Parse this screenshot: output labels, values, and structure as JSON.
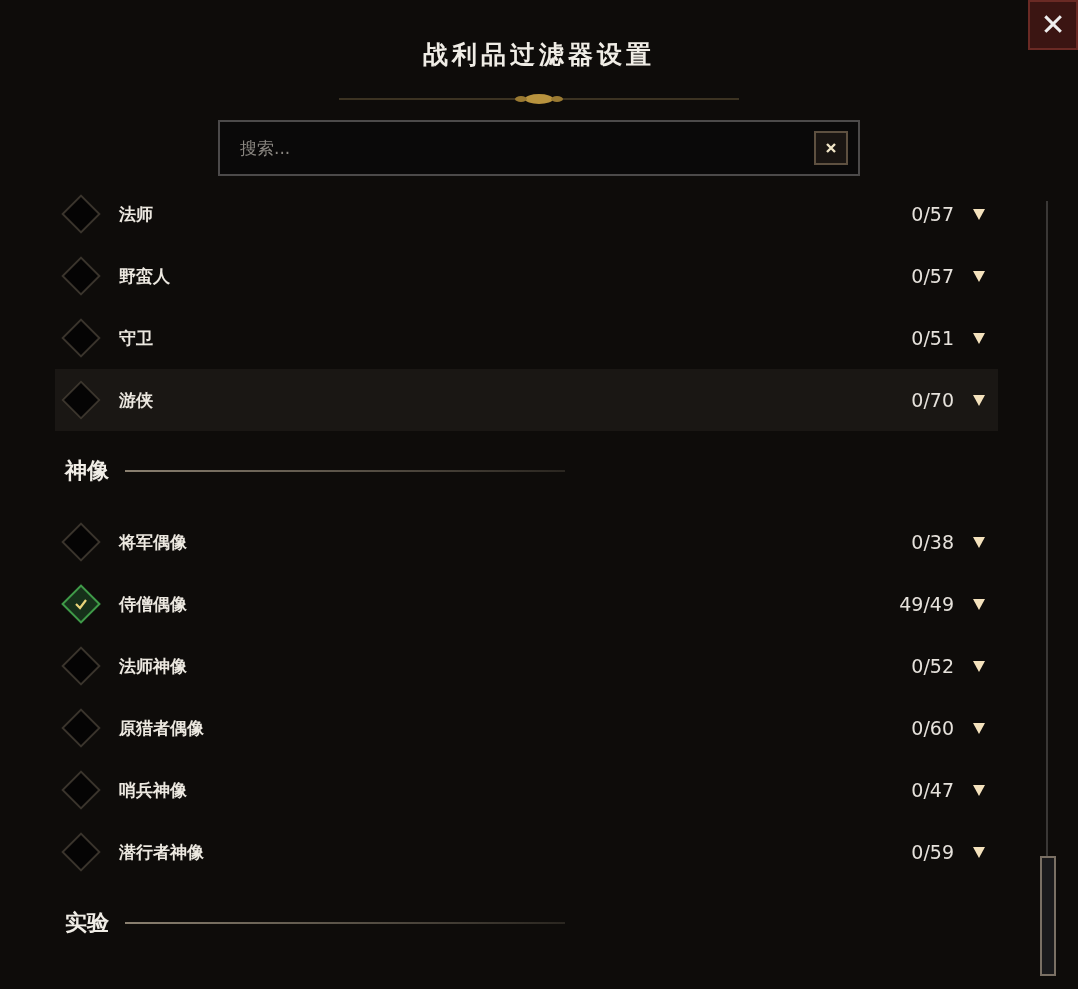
{
  "window": {
    "title": "战利品过滤器设置",
    "close": "✕"
  },
  "search": {
    "placeholder": "搜索..."
  },
  "sections": [
    {
      "items": [
        {
          "name": "法师",
          "count": "0/57",
          "checked": false,
          "hovered": false
        },
        {
          "name": "野蛮人",
          "count": "0/57",
          "checked": false,
          "hovered": false
        },
        {
          "name": "守卫",
          "count": "0/51",
          "checked": false,
          "hovered": false
        },
        {
          "name": "游侠",
          "count": "0/70",
          "checked": false,
          "hovered": true
        }
      ]
    },
    {
      "title": "神像",
      "items": [
        {
          "name": "将军偶像",
          "count": "0/38",
          "checked": false,
          "hovered": false
        },
        {
          "name": "侍僧偶像",
          "count": "49/49",
          "checked": true,
          "hovered": false
        },
        {
          "name": "法师神像",
          "count": "0/52",
          "checked": false,
          "hovered": false
        },
        {
          "name": "原猎者偶像",
          "count": "0/60",
          "checked": false,
          "hovered": false
        },
        {
          "name": "哨兵神像",
          "count": "0/47",
          "checked": false,
          "hovered": false
        },
        {
          "name": "潜行者神像",
          "count": "0/59",
          "checked": false,
          "hovered": false
        }
      ]
    },
    {
      "title": "实验"
    }
  ]
}
